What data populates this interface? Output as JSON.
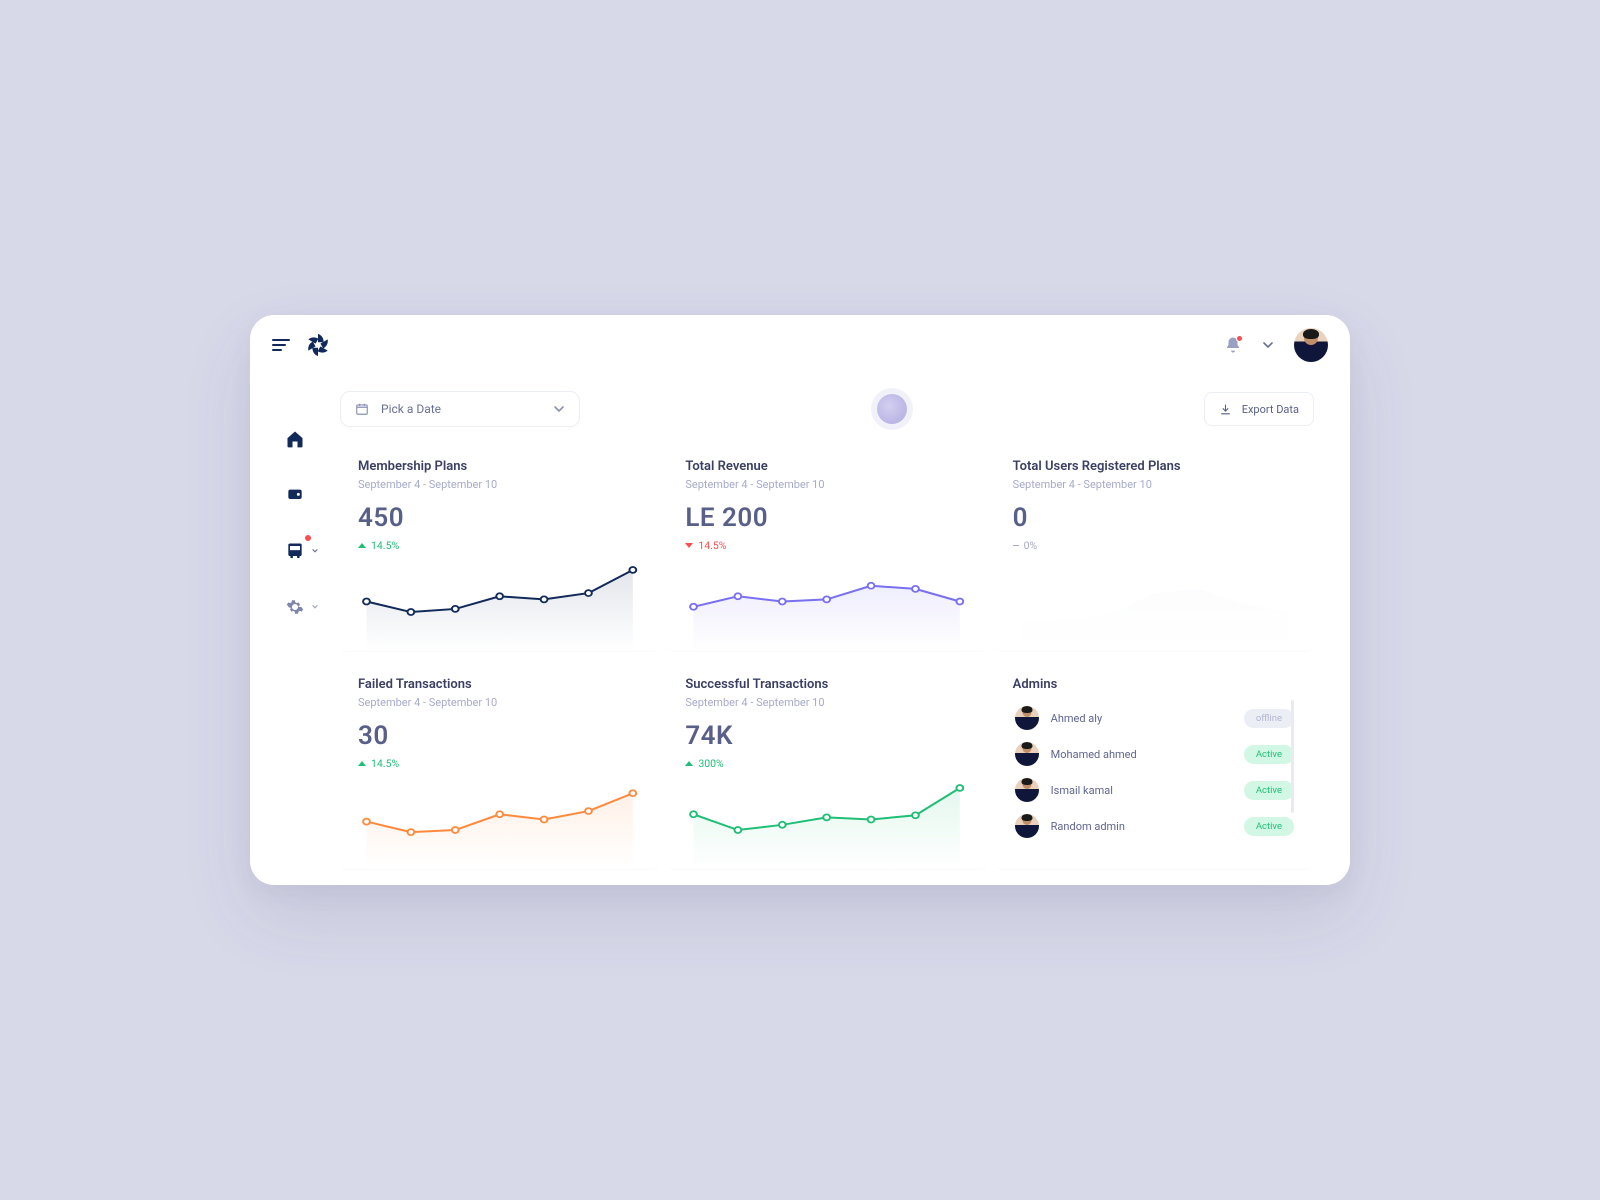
{
  "colors": {
    "navy": "#122a5a",
    "indigo": "#5c5fe0",
    "orange": "#ff8a3d",
    "green": "#1fbf75",
    "red": "#ff4d4f",
    "muted": "#cfd1e5"
  },
  "header": {
    "menu_icon": "hamburger-icon",
    "logo_icon": "swirl-logo-icon",
    "bell_icon": "bell-icon",
    "avatar_icon": "avatar-icon"
  },
  "sidebar": {
    "items": [
      {
        "name": "home",
        "icon": "home-icon",
        "active": true
      },
      {
        "name": "users",
        "icon": "id-card-icon"
      },
      {
        "name": "transport",
        "icon": "bus-icon",
        "has_dot": true,
        "has_caret": true
      },
      {
        "name": "settings",
        "icon": "gear-icon",
        "has_caret": true
      }
    ]
  },
  "toolbar": {
    "date_placeholder": "Pick a Date",
    "date_icon": "calendar-icon",
    "export_label": "Export Data",
    "export_icon": "download-icon"
  },
  "cards": [
    {
      "id": "membership",
      "title": "Membership Plans",
      "sub": "September 4 - September 10",
      "value": "450",
      "delta_dir": "up",
      "delta_text": "14.5%",
      "color": "#122a5a"
    },
    {
      "id": "revenue",
      "title": "Total Revenue",
      "sub": "September 4 - September 10",
      "value": "LE 200",
      "delta_dir": "down",
      "delta_text": "14.5%",
      "color": "#7a6ff0"
    },
    {
      "id": "users",
      "title": "Total Users Registered Plans",
      "sub": "September 4 - September 10",
      "value": "0",
      "delta_dir": "flat",
      "delta_text": "0%",
      "color": "#d6d8ea"
    },
    {
      "id": "failed",
      "title": "Failed Transactions",
      "sub": "September 4 - September 10",
      "value": "30",
      "delta_dir": "up",
      "delta_text": "14.5%",
      "color": "#ff8a3d"
    },
    {
      "id": "success",
      "title": "Successful Transactions",
      "sub": "September 4 - September 10",
      "value": "74K",
      "delta_dir": "up",
      "delta_text": "300%",
      "color": "#1fbf75"
    }
  ],
  "admins": {
    "title": "Admins",
    "status_labels": {
      "active": "Active",
      "offline": "offline"
    },
    "list": [
      {
        "name": "Ahmed aly",
        "status": "offline"
      },
      {
        "name": "Mohamed ahmed",
        "status": "active"
      },
      {
        "name": "Ismail kamal",
        "status": "active"
      },
      {
        "name": "Random admin",
        "status": "active"
      }
    ]
  },
  "chart_data": [
    {
      "card": "membership",
      "type": "line",
      "x": [
        0,
        1,
        2,
        3,
        4,
        5,
        6
      ],
      "values": [
        40,
        30,
        33,
        45,
        42,
        48,
        70
      ],
      "ylim": [
        0,
        80
      ],
      "color": "#122a5a"
    },
    {
      "card": "revenue",
      "type": "line",
      "x": [
        0,
        1,
        2,
        3,
        4,
        5,
        6
      ],
      "values": [
        35,
        45,
        40,
        42,
        55,
        52,
        40
      ],
      "ylim": [
        0,
        80
      ],
      "color": "#7a6ff0"
    },
    {
      "card": "users",
      "type": "area",
      "x": [
        0,
        1,
        2,
        3,
        4,
        5,
        6
      ],
      "values": [
        20,
        22,
        28,
        48,
        52,
        38,
        30
      ],
      "ylim": [
        0,
        80
      ],
      "color": "#e9eaf6"
    },
    {
      "card": "failed",
      "type": "line",
      "x": [
        0,
        1,
        2,
        3,
        4,
        5,
        6
      ],
      "values": [
        38,
        28,
        30,
        45,
        40,
        48,
        65
      ],
      "ylim": [
        0,
        80
      ],
      "color": "#ff8a3d"
    },
    {
      "card": "success",
      "type": "line",
      "x": [
        0,
        1,
        2,
        3,
        4,
        5,
        6
      ],
      "values": [
        45,
        30,
        35,
        42,
        40,
        44,
        70
      ],
      "ylim": [
        0,
        80
      ],
      "color": "#1fbf75"
    }
  ]
}
